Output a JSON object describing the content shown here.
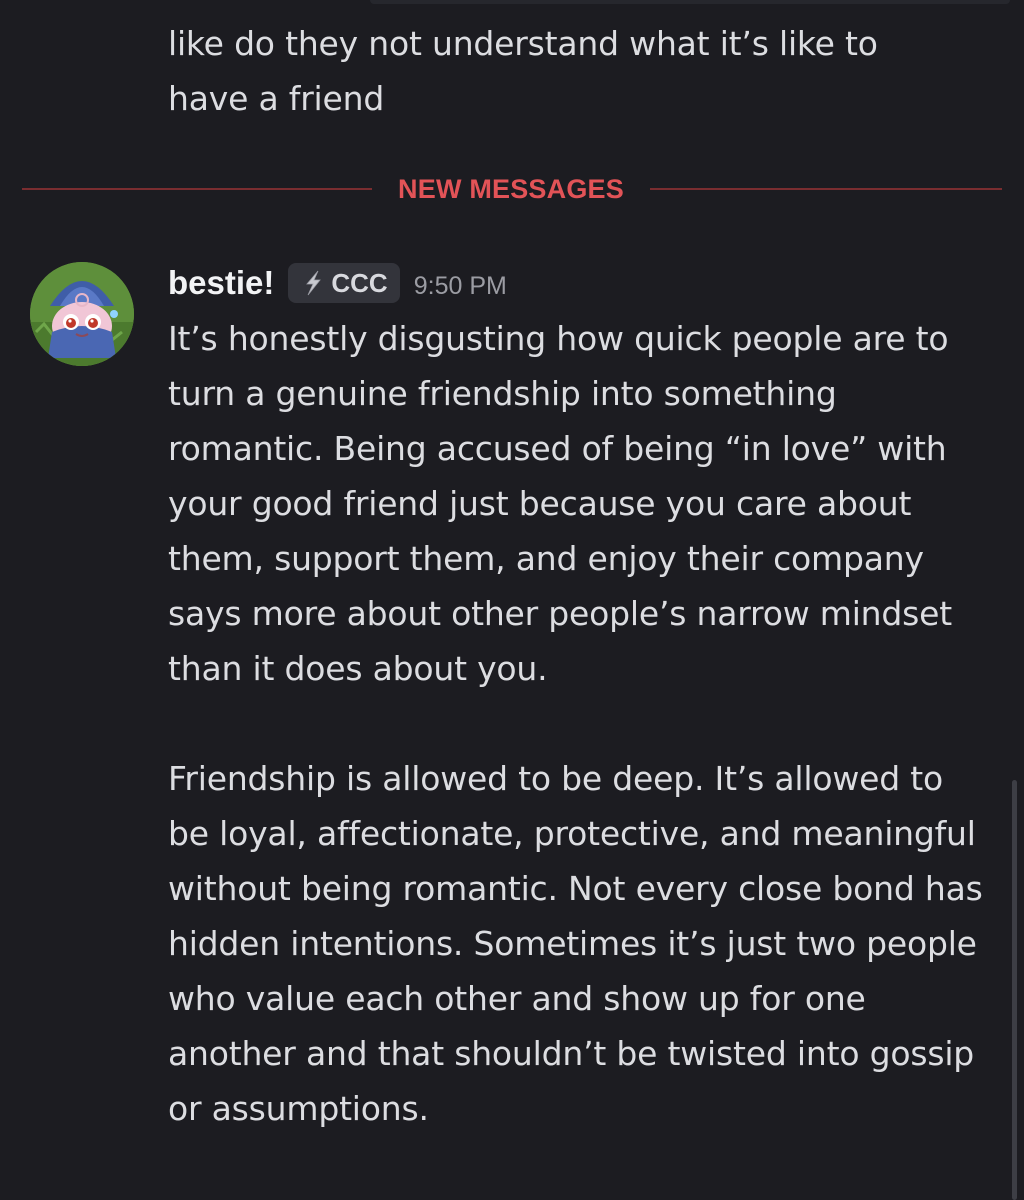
{
  "previous_message": {
    "text": "like do they not understand what it’s like to have a friend"
  },
  "divider": {
    "label": "NEW MESSAGES"
  },
  "message": {
    "username": "bestie!",
    "tag": {
      "icon": "lightning-bolt-icon",
      "label": "CCC"
    },
    "timestamp": "9:50 PM",
    "paragraphs": [
      "It’s honestly disgusting how quick people are to turn a genuine friendship into something romantic. Being accused of being “in love” with your good friend just because you care about them, support them, and enjoy their company says more about other people’s narrow mindset than it does about you.",
      "Friendship is allowed to be deep. It’s allowed to be loyal, affectionate, protective, and meaningful without being romantic. Not every close bond has hidden intentions. Sometimes it’s just two people who value each other and show up for one another and that shouldn’t be twisted into gossip or assumptions."
    ]
  },
  "colors": {
    "background": "#1c1c21",
    "new_messages_accent": "#e25357",
    "text": "#dcdde1",
    "username": "#f2f3f5",
    "timestamp": "#9b9ca3",
    "tag_background": "#33343b"
  }
}
